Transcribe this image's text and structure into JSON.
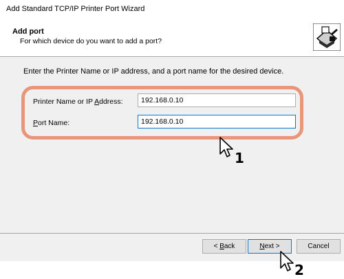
{
  "window": {
    "title": "Add Standard TCP/IP Printer Port Wizard"
  },
  "header": {
    "title": "Add port",
    "subtitle": "For which device do you want to add a port?",
    "icon": "printer-wizard-icon"
  },
  "main": {
    "instruction": "Enter the Printer Name or IP address, and a port name for the desired device.",
    "fields": [
      {
        "label": "Printer Name or IP Address:",
        "value": "192.168.0.10"
      },
      {
        "label": "Port Name:",
        "value": "192.168.0.10"
      }
    ]
  },
  "footer": {
    "back_label": "< Back",
    "next_label": "Next >",
    "cancel_label": "Cancel"
  },
  "annotations": {
    "step1": "1",
    "step2": "2",
    "highlight_color": "#e8957a"
  }
}
